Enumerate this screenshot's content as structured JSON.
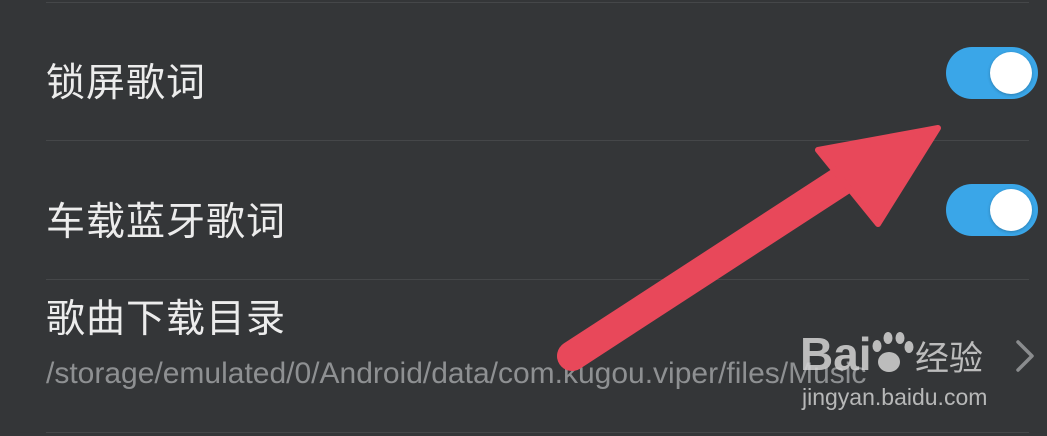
{
  "settings": {
    "items": [
      {
        "label": "锁屏歌词",
        "toggle_on": true
      },
      {
        "label": "车载蓝牙歌词",
        "toggle_on": true
      }
    ],
    "download_dir": {
      "label": "歌曲下载目录",
      "path": "/storage/emulated/0/Android/data/com.kugou.viper/files/Music"
    }
  },
  "watermark": {
    "brand": "Baidu经验",
    "url": "jingyan.baidu.com"
  },
  "colors": {
    "background": "#343638",
    "toggle_active": "#3aa6e8",
    "annotation_arrow": "#e8485a",
    "secondary_text": "#8e9092"
  },
  "icons": {
    "chevron": "chevron-right-icon",
    "annotation": "red-arrow-annotation"
  }
}
